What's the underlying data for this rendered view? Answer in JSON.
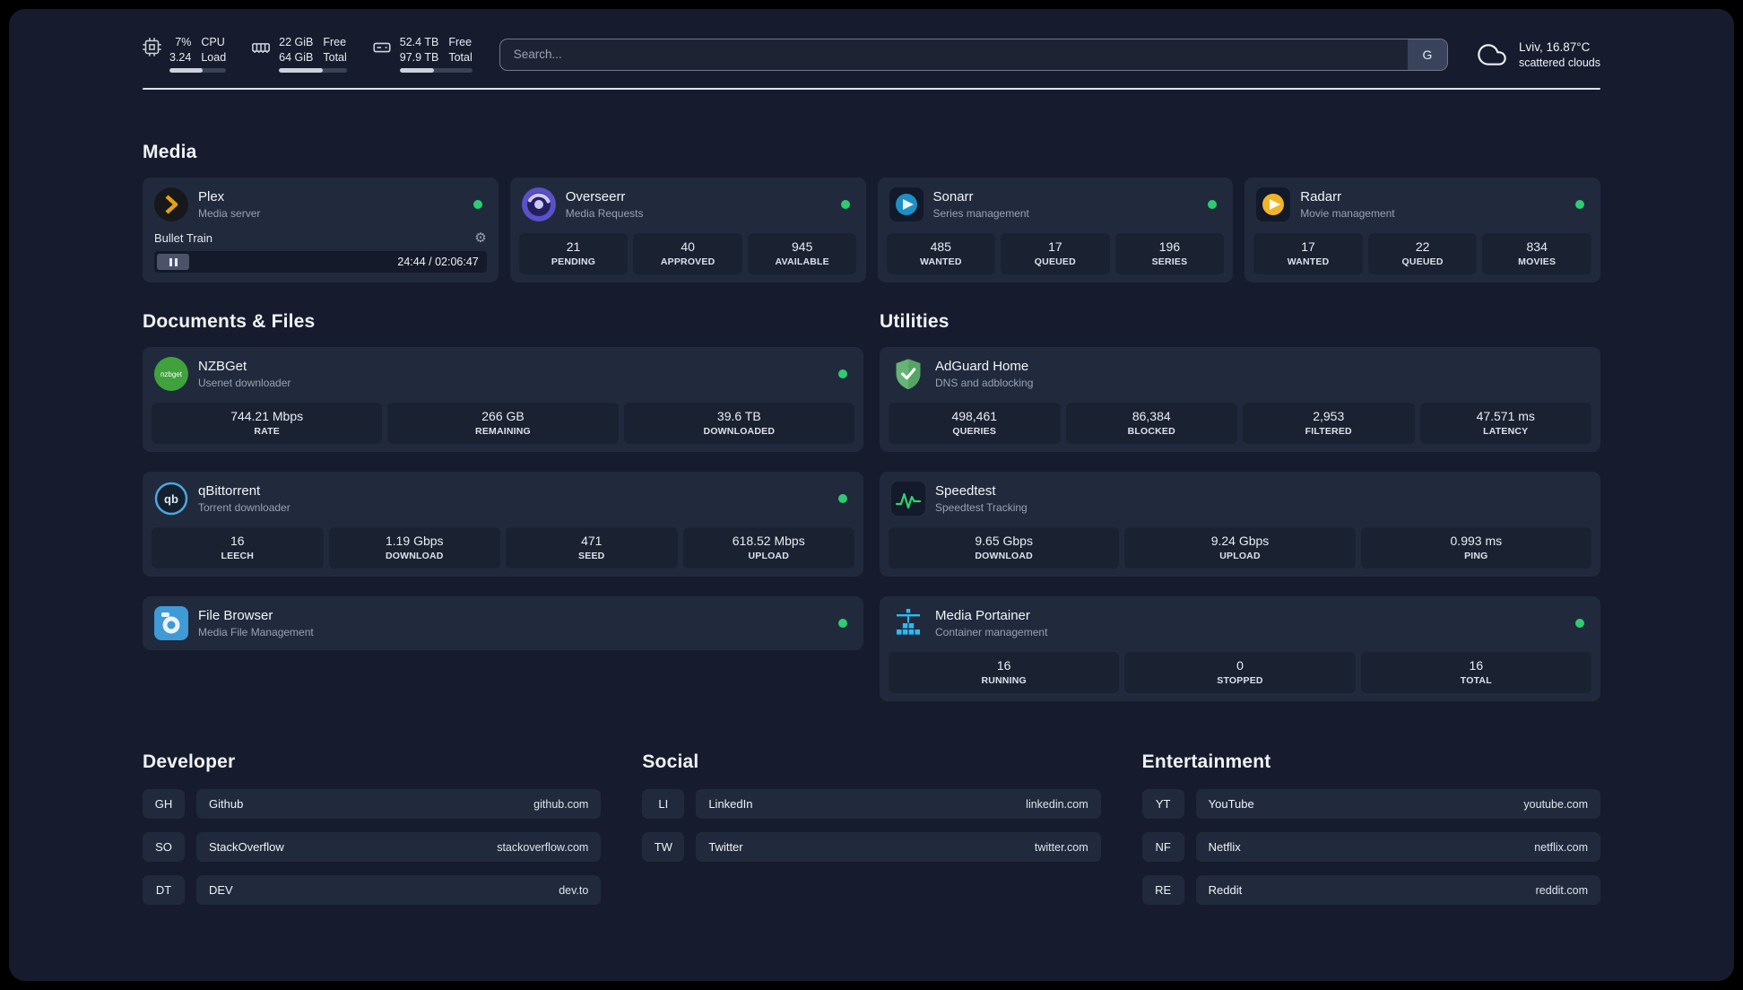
{
  "colors": {
    "background": "#161c2d",
    "card": "#212a3c",
    "tile": "#1a2232",
    "divider": "#dfe3e9",
    "status_online": "#2ecc71",
    "plex_accent": "#e5a00d",
    "overseerr_accent": "#5a50c7",
    "sonarr_accent": "#1f8ec4",
    "radarr_accent": "#f0b429",
    "nzbget_accent": "#3fa23c",
    "qbittorrent_accent": "#4aa8e0",
    "filebrowser_accent": "#3f9ad5",
    "adguard_accent": "#66b574",
    "speedtest_accent": "#2dd36f",
    "portainer_accent": "#2fb9f2"
  },
  "topbar": {
    "cpu": {
      "icon": "cpu-chip-icon",
      "top_value": "7%",
      "bottom_value": "3.24",
      "top_label": "CPU",
      "bottom_label": "Load",
      "bar_percent": 58
    },
    "memory": {
      "icon": "memory-icon",
      "top_value": "22 GiB",
      "bottom_value": "64 GiB",
      "top_label": "Free",
      "bottom_label": "Total",
      "bar_percent": 65
    },
    "disk": {
      "icon": "hard-disk-icon",
      "top_value": "52.4 TB",
      "bottom_value": "97.9 TB",
      "top_label": "Free",
      "bottom_label": "Total",
      "bar_percent": 47
    },
    "search": {
      "placeholder": "Search...",
      "button_label": "G"
    },
    "weather": {
      "icon": "cloud-icon",
      "location": "Lviv, 16.87°C",
      "condition": "scattered clouds"
    }
  },
  "section_titles": {
    "media": "Media",
    "documents": "Documents & Files",
    "utilities": "Utilities",
    "developer": "Developer",
    "social": "Social",
    "entertainment": "Entertainment"
  },
  "services": {
    "plex": {
      "icon": "plex-icon",
      "title": "Plex",
      "subtitle": "Media server",
      "status": "online",
      "player": {
        "track": "Bullet Train",
        "time": "24:44 / 02:06:47"
      }
    },
    "overseerr": {
      "icon": "overseerr-icon",
      "title": "Overseerr",
      "subtitle": "Media Requests",
      "status": "online",
      "stats": [
        {
          "value": "21",
          "label": "PENDING"
        },
        {
          "value": "40",
          "label": "APPROVED"
        },
        {
          "value": "945",
          "label": "AVAILABLE"
        }
      ]
    },
    "sonarr": {
      "icon": "sonarr-icon",
      "title": "Sonarr",
      "subtitle": "Series management",
      "status": "online",
      "stats": [
        {
          "value": "485",
          "label": "WANTED"
        },
        {
          "value": "17",
          "label": "QUEUED"
        },
        {
          "value": "196",
          "label": "SERIES"
        }
      ]
    },
    "radarr": {
      "icon": "radarr-icon",
      "title": "Radarr",
      "subtitle": "Movie management",
      "status": "online",
      "stats": [
        {
          "value": "17",
          "label": "WANTED"
        },
        {
          "value": "22",
          "label": "QUEUED"
        },
        {
          "value": "834",
          "label": "MOVIES"
        }
      ]
    },
    "nzbget": {
      "icon": "nzbget-icon",
      "title": "NZBGet",
      "subtitle": "Usenet downloader",
      "status": "online",
      "stats": [
        {
          "value": "744.21 Mbps",
          "label": "RATE"
        },
        {
          "value": "266 GB",
          "label": "REMAINING"
        },
        {
          "value": "39.6 TB",
          "label": "DOWNLOADED"
        }
      ]
    },
    "qbittorrent": {
      "icon": "qbittorrent-icon",
      "title": "qBittorrent",
      "subtitle": "Torrent downloader",
      "status": "online",
      "stats": [
        {
          "value": "16",
          "label": "LEECH"
        },
        {
          "value": "1.19 Gbps",
          "label": "DOWNLOAD"
        },
        {
          "value": "471",
          "label": "SEED"
        },
        {
          "value": "618.52 Mbps",
          "label": "UPLOAD"
        }
      ]
    },
    "filebrowser": {
      "icon": "filebrowser-icon",
      "title": "File Browser",
      "subtitle": "Media File Management",
      "status": "online"
    },
    "adguard": {
      "icon": "adguard-icon",
      "title": "AdGuard Home",
      "subtitle": "DNS and adblocking",
      "stats": [
        {
          "value": "498,461",
          "label": "QUERIES"
        },
        {
          "value": "86,384",
          "label": "BLOCKED"
        },
        {
          "value": "2,953",
          "label": "FILTERED"
        },
        {
          "value": "47.571 ms",
          "label": "LATENCY"
        }
      ]
    },
    "speedtest": {
      "icon": "speedtest-icon",
      "title": "Speedtest",
      "subtitle": "Speedtest Tracking",
      "stats": [
        {
          "value": "9.65 Gbps",
          "label": "DOWNLOAD"
        },
        {
          "value": "9.24 Gbps",
          "label": "UPLOAD"
        },
        {
          "value": "0.993 ms",
          "label": "PING"
        }
      ]
    },
    "portainer": {
      "icon": "portainer-icon",
      "title": "Media Portainer",
      "subtitle": "Container management",
      "status": "online",
      "stats": [
        {
          "value": "16",
          "label": "RUNNING"
        },
        {
          "value": "0",
          "label": "STOPPED"
        },
        {
          "value": "16",
          "label": "TOTAL"
        }
      ]
    }
  },
  "bookmarks": {
    "developer": [
      {
        "abbr": "GH",
        "name": "Github",
        "url": "github.com"
      },
      {
        "abbr": "SO",
        "name": "StackOverflow",
        "url": "stackoverflow.com"
      },
      {
        "abbr": "DT",
        "name": "DEV",
        "url": "dev.to"
      }
    ],
    "social": [
      {
        "abbr": "LI",
        "name": "LinkedIn",
        "url": "linkedin.com"
      },
      {
        "abbr": "TW",
        "name": "Twitter",
        "url": "twitter.com"
      }
    ],
    "entertainment": [
      {
        "abbr": "YT",
        "name": "YouTube",
        "url": "youtube.com"
      },
      {
        "abbr": "NF",
        "name": "Netflix",
        "url": "netflix.com"
      },
      {
        "abbr": "RE",
        "name": "Reddit",
        "url": "reddit.com"
      }
    ]
  }
}
